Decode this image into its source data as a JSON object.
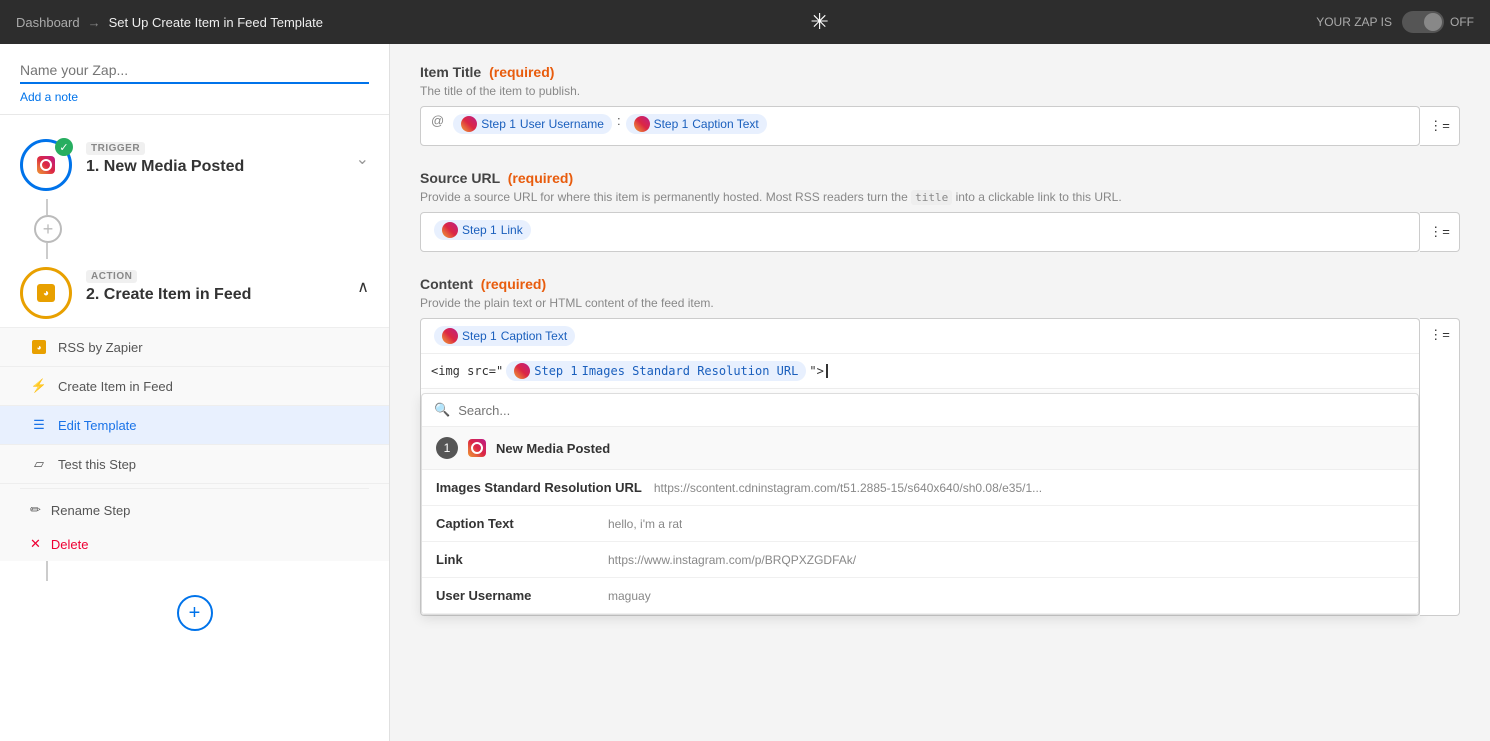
{
  "topbar": {
    "breadcrumb_dashboard": "Dashboard",
    "arrow": "→",
    "page_title": "Set Up Create Item in Feed Template",
    "asterisk": "✳",
    "zap_is_label": "YOUR ZAP IS",
    "toggle_state": "OFF"
  },
  "left_panel": {
    "zap_name_placeholder": "Name your Zap...",
    "add_note": "Add a note",
    "trigger": {
      "tag": "TRIGGER",
      "title": "1. New Media Posted"
    },
    "action": {
      "tag": "ACTION",
      "title": "2. Create Item in Feed",
      "submenu": {
        "rss_label": "RSS by Zapier",
        "create_item_label": "Create Item in Feed",
        "edit_template_label": "Edit Template",
        "test_step_label": "Test this Step",
        "rename_step_label": "Rename Step",
        "delete_label": "Delete"
      }
    }
  },
  "right_panel": {
    "item_title": {
      "label": "Item Title",
      "required": "(required)",
      "description": "The title of the item to publish.",
      "token_at": "@",
      "token1_step": "Step 1",
      "token1_name": "User Username",
      "colon": ":",
      "token2_step": "Step 1",
      "token2_name": "Caption Text"
    },
    "source_url": {
      "label": "Source URL",
      "required": "(required)",
      "description_before": "Provide a source URL for where this item is permanently hosted. Most RSS readers turn the",
      "code": "title",
      "description_after": "into a clickable link to this URL.",
      "token_step": "Step 1",
      "token_name": "Link"
    },
    "content": {
      "label": "Content",
      "required": "(required)",
      "description": "Provide the plain text or HTML content of the feed item.",
      "token_step": "Step 1",
      "token_name": "Caption Text",
      "body_prefix": "<img src=\"",
      "body_token_step": "Step 1",
      "body_token_name": "Images Standard Resolution URL",
      "body_suffix": "\">"
    },
    "dropdown": {
      "search_placeholder": "Search...",
      "group_number": "1",
      "group_name": "New Media Posted",
      "items": [
        {
          "name": "Images Standard Resolution URL",
          "value": "https://scontent.cdninstagram.com/t51.2885-15/s640x640/sh0.08/e35/1..."
        },
        {
          "name": "Caption Text",
          "value": "hello, i'm a rat"
        },
        {
          "name": "Link",
          "value": "https://www.instagram.com/p/BRQPXZGDFAk/"
        },
        {
          "name": "User Username",
          "value": "maguay"
        }
      ]
    }
  }
}
